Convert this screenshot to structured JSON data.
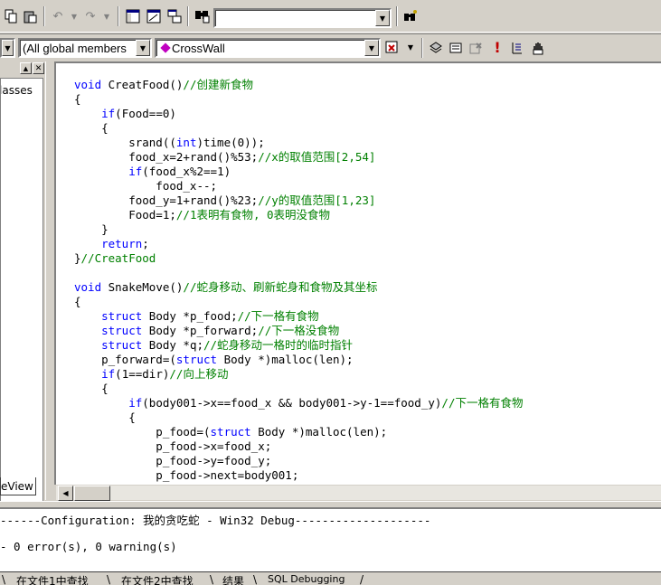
{
  "toolbar1": {
    "search_value": "",
    "icons": [
      "copy-icon",
      "paste-icon",
      "undo-icon",
      "redo-icon",
      "workspace-icon",
      "output-icon",
      "window-list-icon",
      "find-in-files-icon",
      "find-icon"
    ]
  },
  "toolbar2": {
    "scope_combo": "(All global members",
    "function_combo": "CrossWall"
  },
  "left_pane": {
    "tree_item": "lasses",
    "tab_label": "eView"
  },
  "editor": {
    "lines": [
      [
        [
          "kw",
          "void"
        ],
        [
          "t",
          " CreatFood()"
        ],
        [
          "cm",
          "//创建新食物"
        ]
      ],
      [
        [
          "t",
          "{"
        ]
      ],
      [
        [
          "t",
          "    "
        ],
        [
          "kw",
          "if"
        ],
        [
          "t",
          "(Food==0)"
        ]
      ],
      [
        [
          "t",
          "    {"
        ]
      ],
      [
        [
          "t",
          "        srand(("
        ],
        [
          "kw",
          "int"
        ],
        [
          "t",
          ")time(0));"
        ]
      ],
      [
        [
          "t",
          "        food_x=2+rand()%53;"
        ],
        [
          "cm",
          "//x的取值范围[2,54]"
        ]
      ],
      [
        [
          "t",
          "        "
        ],
        [
          "kw",
          "if"
        ],
        [
          "t",
          "(food_x%2==1)"
        ]
      ],
      [
        [
          "t",
          "            food_x--;"
        ]
      ],
      [
        [
          "t",
          "        food_y=1+rand()%23;"
        ],
        [
          "cm",
          "//y的取值范围[1,23]"
        ]
      ],
      [
        [
          "t",
          "        Food=1;"
        ],
        [
          "cm",
          "//1表明有食物, 0表明没食物"
        ]
      ],
      [
        [
          "t",
          "    }"
        ]
      ],
      [
        [
          "t",
          "    "
        ],
        [
          "kw",
          "return"
        ],
        [
          "t",
          ";"
        ]
      ],
      [
        [
          "t",
          "}"
        ],
        [
          "cm",
          "//CreatFood"
        ]
      ],
      [
        [
          "t",
          ""
        ]
      ],
      [
        [
          "kw",
          "void"
        ],
        [
          "t",
          " SnakeMove()"
        ],
        [
          "cm",
          "//蛇身移动、刷新蛇身和食物及其坐标"
        ]
      ],
      [
        [
          "t",
          "{"
        ]
      ],
      [
        [
          "t",
          "    "
        ],
        [
          "kw",
          "struct"
        ],
        [
          "t",
          " Body *p_food;"
        ],
        [
          "cm",
          "//下一格有食物"
        ]
      ],
      [
        [
          "t",
          "    "
        ],
        [
          "kw",
          "struct"
        ],
        [
          "t",
          " Body *p_forward;"
        ],
        [
          "cm",
          "//下一格没食物"
        ]
      ],
      [
        [
          "t",
          "    "
        ],
        [
          "kw",
          "struct"
        ],
        [
          "t",
          " Body *q;"
        ],
        [
          "cm",
          "//蛇身移动一格时的临时指针"
        ]
      ],
      [
        [
          "t",
          "    p_forward=("
        ],
        [
          "kw",
          "struct"
        ],
        [
          "t",
          " Body *)malloc(len);"
        ]
      ],
      [
        [
          "t",
          "    "
        ],
        [
          "kw",
          "if"
        ],
        [
          "t",
          "(1==dir)"
        ],
        [
          "cm",
          "//向上移动"
        ]
      ],
      [
        [
          "t",
          "    {"
        ]
      ],
      [
        [
          "t",
          "        "
        ],
        [
          "kw",
          "if"
        ],
        [
          "t",
          "(body001->x==food_x && body001->y-1==food_y)"
        ],
        [
          "cm",
          "//下一格有食物"
        ]
      ],
      [
        [
          "t",
          "        {"
        ]
      ],
      [
        [
          "t",
          "            p_food=("
        ],
        [
          "kw",
          "struct"
        ],
        [
          "t",
          " Body *)malloc(len);"
        ]
      ],
      [
        [
          "t",
          "            p_food->x=food_x;"
        ]
      ],
      [
        [
          "t",
          "            p_food->y=food_y;"
        ]
      ],
      [
        [
          "t",
          "            p_food->next=body001;"
        ]
      ]
    ]
  },
  "output": {
    "config_line": "------Configuration: 我的贪吃蛇 - Win32 Debug--------------------",
    "result_line": "- 0 error(s), 0 warning(s)"
  },
  "bottom_tabs": [
    "在文件1中查找",
    "在文件2中查找",
    "结果",
    "SQL Debugging"
  ]
}
